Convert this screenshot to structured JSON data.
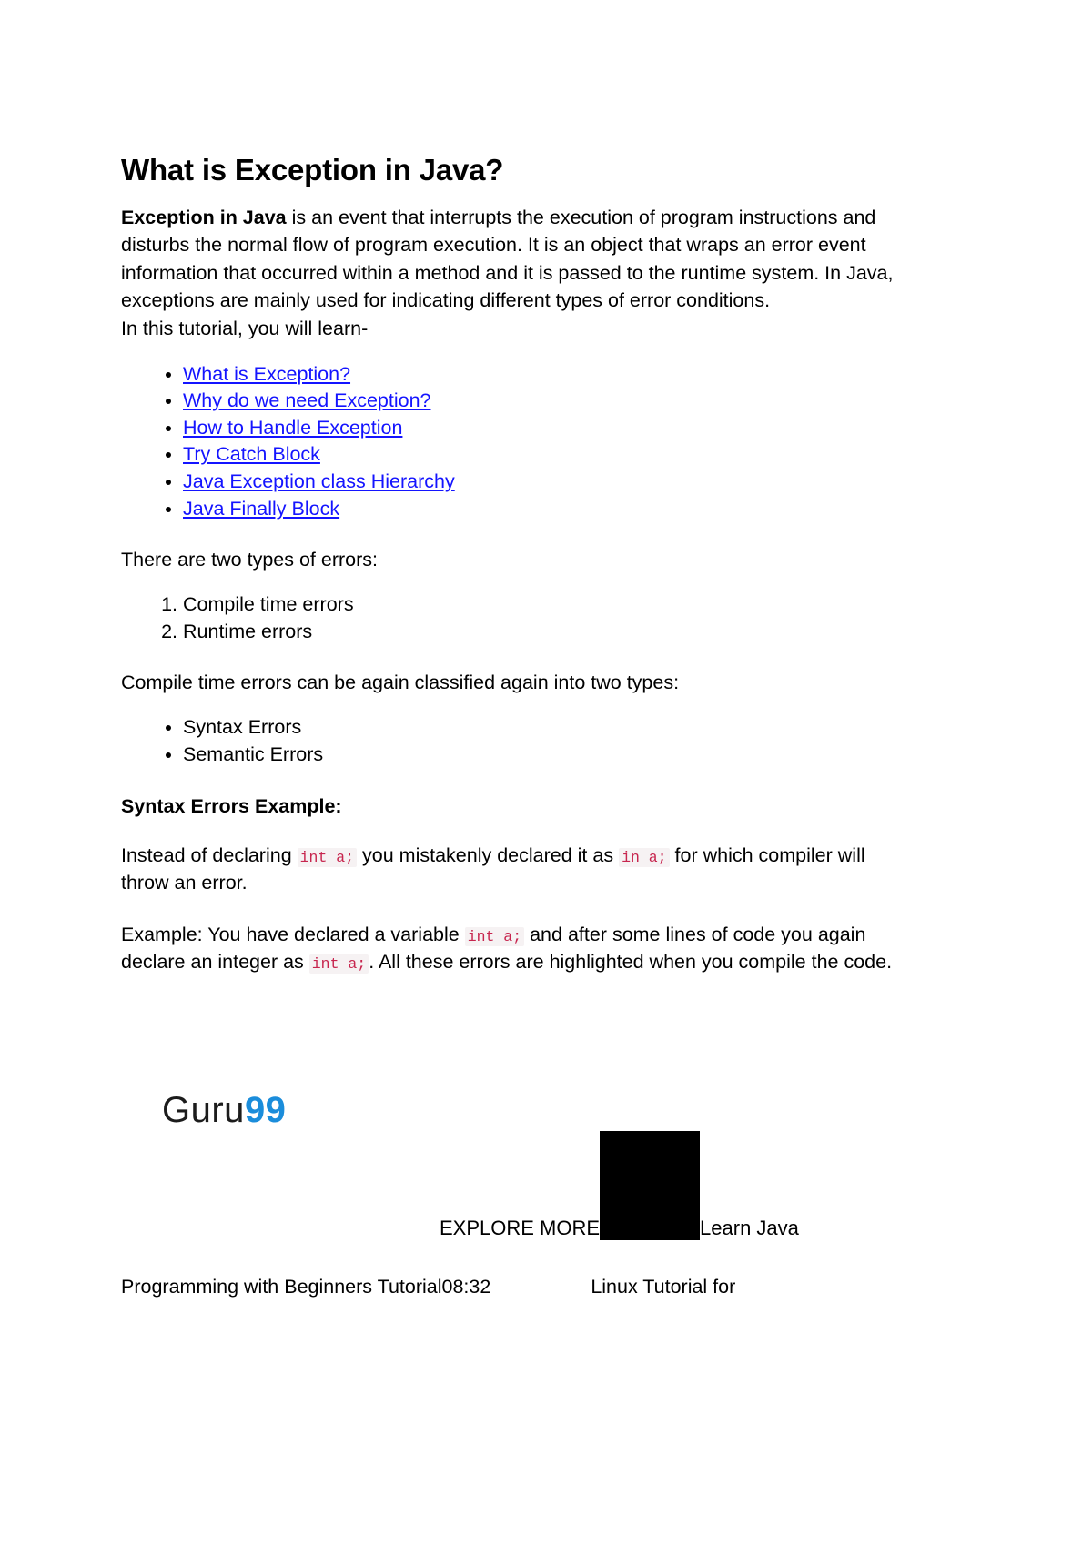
{
  "document": {
    "title": "What is Exception in Java?",
    "intro": {
      "lead": "Exception in Java",
      "rest": " is an event that interrupts the execution of program instructions and disturbs the normal flow of program execution. It is an object that wraps an error event information that occurred within a method and it is passed to the runtime system. In Java, exceptions are mainly used for indicating different types of error conditions.",
      "tutorial_line": "In this tutorial, you will learn-"
    },
    "toc": {
      "links": [
        "What is Exception?",
        "Why do we need Exception?",
        "How to Handle Exception",
        "Try Catch Block",
        "Java Exception class Hierarchy",
        "Java Finally Block"
      ],
      "link_color": "#1414ff"
    },
    "error_types": {
      "intro": "There are two types of errors:",
      "items": [
        "Compile time errors",
        "Runtime errors"
      ]
    },
    "compile_time": {
      "intro": "Compile time errors can be again classified again into two types:",
      "items": [
        "Syntax Errors",
        "Semantic Errors"
      ]
    },
    "syntax_section": {
      "heading": "Syntax Errors Example:",
      "para1": {
        "part1": "Instead of declaring ",
        "code1": "int a;",
        "part2": " you mistakenly declared it as ",
        "code2": "in a;",
        "part3": " for which compiler will throw an error."
      },
      "para2": {
        "part1": "Example: You have declared a variable ",
        "code1": "int a;",
        "part2": " and after some lines of code you again declare an integer as ",
        "code2": "int a;",
        "part3": ". All these errors are highlighted when you compile the code."
      }
    },
    "code_style": {
      "text_color": "#c7254e",
      "background": "#f6f2f3"
    },
    "branding": {
      "logo_text_primary": "Guru",
      "logo_text_accent": "99",
      "logo_accent_color": "#1b8ddb"
    },
    "promo": {
      "explore_label": "EXPLORE MORE",
      "after_thumb_text": "Learn Java"
    },
    "footer": {
      "left_text": "Programming with Beginners Tutorial08:32",
      "right_text": "Linux Tutorial for"
    }
  }
}
